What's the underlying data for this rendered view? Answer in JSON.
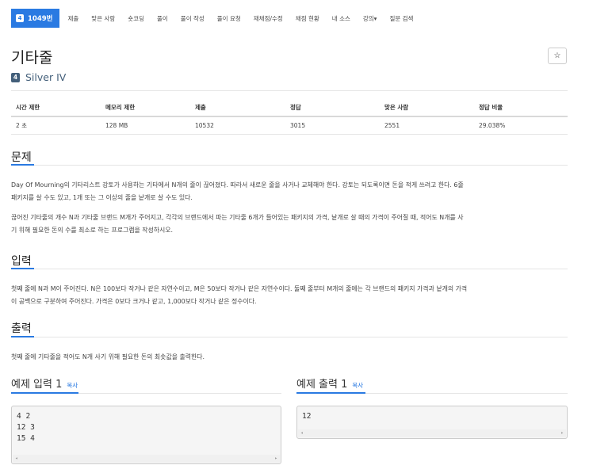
{
  "nav": {
    "active": {
      "tier": "4",
      "label": "1049번"
    },
    "items": [
      "제출",
      "맞은 사람",
      "숏코딩",
      "풀이",
      "풀이 작성",
      "풀이 요청",
      "재채점/수정",
      "채점 현황",
      "내 소스",
      "강의▾",
      "질문 검색"
    ]
  },
  "problem": {
    "title": "기타줄",
    "star_icon": "☆",
    "tier": {
      "badge": "4",
      "text": "Silver IV",
      "color": "#435f7a"
    }
  },
  "info_table": {
    "headers": [
      "시간 제한",
      "메모리 제한",
      "제출",
      "정답",
      "맞은 사람",
      "정답 비율"
    ],
    "values": [
      "2 초",
      "128 MB",
      "10532",
      "3015",
      "2551",
      "29.038%"
    ]
  },
  "sections": {
    "problem": {
      "heading": "문제",
      "para1_line1": "Day Of Mourning의 기타리스트 강토가 사용하는 기타에서 N개의 줄이 끊어졌다. 따라서 새로운 줄을 사거나 교체해야 한다. 강토는 되도록이면 돈을 적게 쓰려고 한다. 6줄",
      "para1_line2": "패키지를 살 수도 있고, 1개 또는 그 이상의 줄을 낱개로 살 수도 있다.",
      "para2_line1": "끊어진 기타줄의 개수 N과 기타줄 브랜드 M개가 주어지고, 각각의 브랜드에서 파는 기타줄 6개가 들어있는 패키지의 가격, 낱개로 살 때의 가격이 주어질 때, 적어도 N개를 사",
      "para2_line2": "기 위해 필요한 돈의 수를 최소로 하는 프로그램을 작성하시오."
    },
    "input": {
      "heading": "입력",
      "line1": "첫째 줄에 N과 M이 주어진다. N은 100보다 작거나 같은 자연수이고, M은 50보다 작거나 같은 자연수이다. 둘째 줄부터 M개의 줄에는 각 브랜드의 패키지 가격과 낱개의 가격",
      "line2": "이 공백으로 구분하여 주어진다. 가격은 0보다 크거나 같고, 1,000보다 작거나 같은 정수이다."
    },
    "output": {
      "heading": "출력",
      "line1": "첫째 줄에 기타줄을 적어도 N개 사기 위해 필요한 돈의 최솟값을 출력한다."
    }
  },
  "examples": {
    "input": {
      "heading": "예제 입력 1",
      "copy": "복사",
      "lines": [
        "4 2",
        "12 3",
        "15 4"
      ]
    },
    "output": {
      "heading": "예제 출력 1",
      "copy": "복사",
      "lines": [
        "12"
      ]
    },
    "scroll_left": "◂",
    "scroll_right": "▸"
  }
}
